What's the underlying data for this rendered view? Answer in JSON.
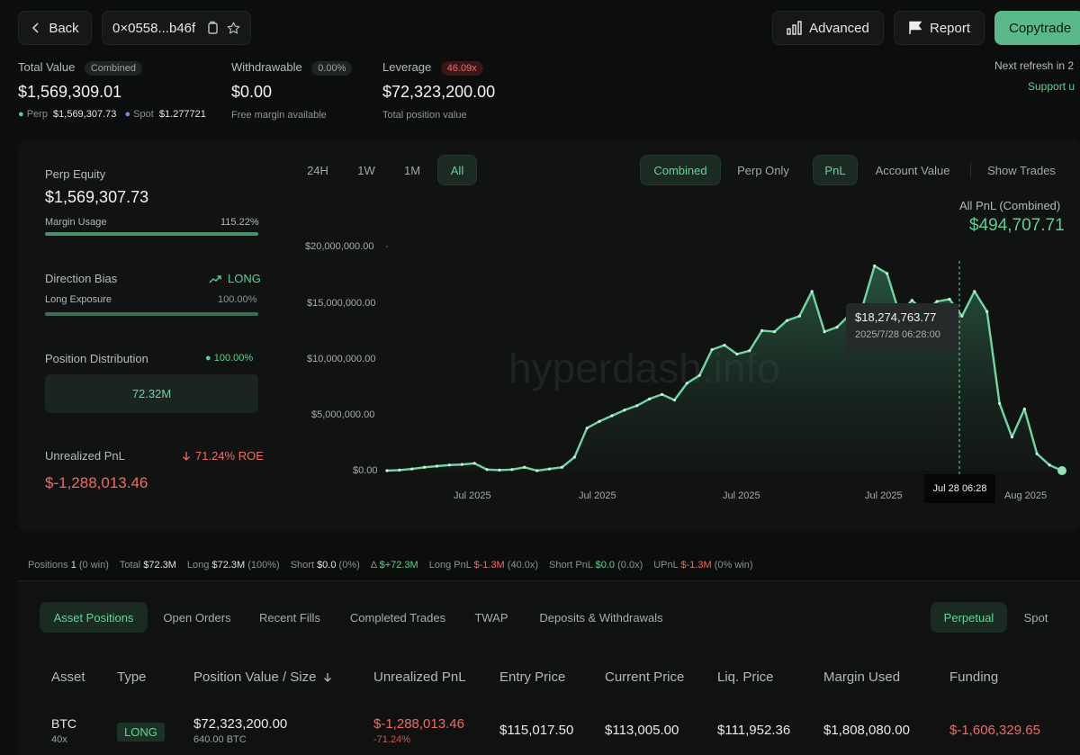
{
  "header": {
    "back_label": "Back",
    "address": "0×0558...b46f",
    "advanced_label": "Advanced",
    "report_label": "Report",
    "copytrade_label": "Copytrade"
  },
  "summary": {
    "total_value_label": "Total Value",
    "total_value_badge": "Combined",
    "total_value": "$1,569,309.01",
    "perp_label": "Perp",
    "perp_value": "$1,569,307.73",
    "spot_label": "Spot",
    "spot_value": "$1.277721",
    "withdrawable_label": "Withdrawable",
    "withdrawable_badge": "0.00%",
    "withdrawable_value": "$0.00",
    "withdrawable_sub": "Free margin available",
    "leverage_label": "Leverage",
    "leverage_badge": "46.09x",
    "leverage_value": "$72,323,200.00",
    "leverage_sub": "Total position value",
    "refresh_text": "Next refresh in 2",
    "support_text": "Support u"
  },
  "left_panel": {
    "perp_equity_label": "Perp Equity",
    "perp_equity_value": "$1,569,307.73",
    "margin_usage_label": "Margin Usage",
    "margin_usage_value": "115.22%",
    "margin_usage_fill": 1.0,
    "direction_bias_label": "Direction Bias",
    "direction_bias_value": "LONG",
    "long_exposure_label": "Long Exposure",
    "long_exposure_value": "100.00%",
    "long_exposure_fill": 1.0,
    "position_distribution_label": "Position Distribution",
    "position_distribution_value": "100.00%",
    "distribution_box_value": "72.32M",
    "unrealized_pnl_label": "Unrealized PnL",
    "roe_value": "71.24% ROE",
    "unrealized_pnl_value": "$-1,288,013.46"
  },
  "chart_controls": {
    "ranges": [
      "24H",
      "1W",
      "1M",
      "All"
    ],
    "active_range": "All",
    "mode_combined": "Combined",
    "mode_perp_only": "Perp Only",
    "metric_pnl": "PnL",
    "metric_account_value": "Account Value",
    "show_trades": "Show Trades",
    "pnl_caption": "All PnL (Combined)",
    "pnl_value": "$494,707.71",
    "watermark": "hyperdash.info"
  },
  "tooltip": {
    "value": "$18,274,763.77",
    "date": "2025/7/28 06:28:00",
    "axis_label": "Jul 28 06:28"
  },
  "colors": {
    "accent_green": "#5dcf94",
    "negative_red": "#ee6b65",
    "background": "#0c0d0d"
  },
  "chart_data": {
    "type": "area",
    "title": "",
    "ylim": [
      0,
      20000000
    ],
    "y_ticks": [
      "$20,000,000.00",
      "$15,000,000.00",
      "$10,000,000.00",
      "$5,000,000.00",
      "$0.00"
    ],
    "x_ticks": [
      "Jul 2025",
      "Jul 2025",
      "Jul 2025",
      "Jul 2025",
      "Aug 2025"
    ],
    "series": [
      {
        "name": "PnL",
        "values": [
          0,
          50000,
          150000,
          300000,
          400000,
          500000,
          550000,
          650000,
          100000,
          50000,
          100000,
          300000,
          0,
          150000,
          300000,
          1200000,
          3800000,
          4400000,
          4900000,
          5400000,
          5800000,
          6400000,
          6800000,
          6300000,
          7800000,
          8500000,
          10800000,
          11200000,
          10400000,
          10700000,
          12500000,
          12400000,
          13400000,
          13800000,
          16000000,
          12400000,
          12800000,
          13900000,
          14500000,
          18274763.77,
          17600000,
          14000000,
          15200000,
          14200000,
          15100000,
          15300000,
          13800000,
          16000000,
          14200000,
          6000000,
          3000000,
          5500000,
          1500000,
          500000,
          0
        ]
      }
    ]
  },
  "stats_bar": {
    "positions_label": "Positions",
    "positions_value": "1",
    "positions_note": "(0 win)",
    "total_label": "Total",
    "total_value": "$72.3M",
    "long_label": "Long",
    "long_value": "$72.3M",
    "long_note": "(100%)",
    "short_label": "Short",
    "short_value": "$0.0",
    "short_note": "(0%)",
    "delta_label": "Δ",
    "delta_value": "$+72.3M",
    "long_pnl_label": "Long PnL",
    "long_pnl_value": "$-1.3M",
    "long_pnl_note": "(40.0x)",
    "short_pnl_label": "Short PnL",
    "short_pnl_value": "$0.0",
    "short_pnl_note": "(0.0x)",
    "upnl_label": "UPnL",
    "upnl_value": "$-1.3M",
    "upnl_note": "(0% win)"
  },
  "tabs": {
    "items": [
      "Asset Positions",
      "Open Orders",
      "Recent Fills",
      "Completed Trades",
      "TWAP",
      "Deposits & Withdrawals"
    ],
    "perpetual": "Perpetual",
    "spot": "Spot"
  },
  "table": {
    "headers": [
      "Asset",
      "Type",
      "Position Value / Size",
      "Unrealized PnL",
      "Entry Price",
      "Current Price",
      "Liq. Price",
      "Margin Used",
      "Funding"
    ],
    "rows": [
      {
        "asset": "BTC",
        "leverage": "40x",
        "type": "LONG",
        "position_value": "$72,323,200.00",
        "size": "640.00 BTC",
        "unrealized_pnl": "$-1,288,013.46",
        "unrealized_pct": "-71.24%",
        "entry_price": "$115,017.50",
        "current_price": "$113,005.00",
        "liq_price": "$111,952.36",
        "margin_used": "$1,808,080.00",
        "funding": "$-1,606,329.65"
      }
    ]
  }
}
